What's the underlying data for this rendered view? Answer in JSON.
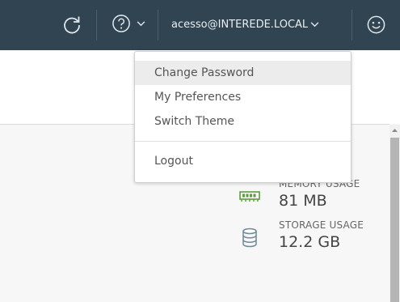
{
  "header": {
    "refresh_icon": "refresh-icon",
    "help_icon": "help-circle-icon",
    "user_label": "acesso@INTEREDE.LOCAL",
    "user_chevron_icon": "chevron-down-icon",
    "avatar_icon": "smiley-face-icon",
    "background_color": "#314452"
  },
  "user_dropdown": {
    "items": [
      {
        "label": "Change Password",
        "active": true
      },
      {
        "label": "My Preferences"
      },
      {
        "label": "Switch Theme"
      }
    ],
    "logout_label": "Logout"
  },
  "stats": {
    "memory": {
      "label": "MEMORY USAGE",
      "value": "81 MB",
      "icon": "memory-chip-icon",
      "icon_color": "#5a9e3e"
    },
    "storage": {
      "label": "STORAGE USAGE",
      "value": "12.2 GB",
      "icon": "database-icon",
      "icon_color": "#6e8a96"
    }
  }
}
